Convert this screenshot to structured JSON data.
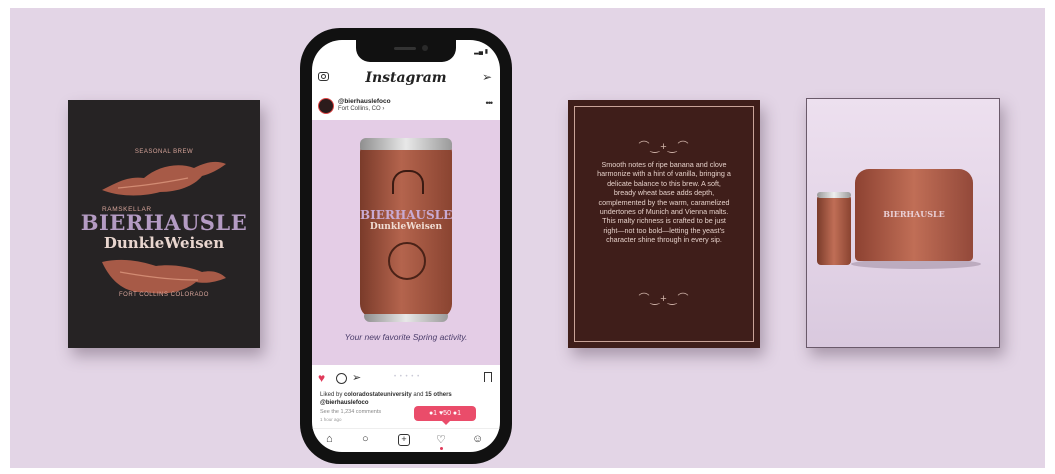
{
  "poster_dark": {
    "seasonal": "SEASONAL BREW",
    "ramskellar": "RAMSKELLAR",
    "brand": "BIERHAUSLE",
    "beer": "DunkleWeisen",
    "location": "FORT COLLINS COLORADO"
  },
  "phone": {
    "app_name": "Instagram",
    "username": "@bierhauslefoco",
    "location": "Fort Collins, CO",
    "location_chevron": "›",
    "more": "•••",
    "can_brand": "BIERHAUSLE",
    "can_beer": "DunkleWeisen",
    "caption": "Your new favorite Spring activity.",
    "liked_prefix": "Liked by",
    "liked_user": "coloradostateuniversity",
    "liked_and": "and",
    "liked_others": "15 others",
    "post_author": "@bierhauslefoco",
    "see_all": "See the 1,234 comments",
    "time_ago": "1 hour ago",
    "notification": "●1 ♥50 ●1",
    "carousel": "• • • • •"
  },
  "poster_text": {
    "flourish": "⌒‿+‿⌒",
    "description": "Smooth notes of ripe banana and clove harmonize with a hint of vanilla, bringing a delicate balance to this brew. A soft, bready wheat base adds depth, complemented by the warm, caramelized undertones of Munich and Vienna malts. This malty richness is crafted to be just right—not too bold—letting the yeast's character shine through in every sip."
  },
  "photo": {
    "pack_label": "BIERHAUSLE"
  },
  "icons": {
    "camera": "camera-icon",
    "send": "send-icon",
    "heart": "heart-icon",
    "comment": "comment-icon",
    "share": "share-icon",
    "bookmark": "bookmark-icon",
    "home": "home-icon",
    "search": "search-icon",
    "add": "add-icon",
    "activity": "activity-icon",
    "profile": "profile-icon"
  },
  "colors": {
    "background": "#e3d5e6",
    "poster_dark": "#262324",
    "poster_brown": "#3f1e1a",
    "accent_pink": "#ea4c6a",
    "lavender": "#b49bc3"
  }
}
